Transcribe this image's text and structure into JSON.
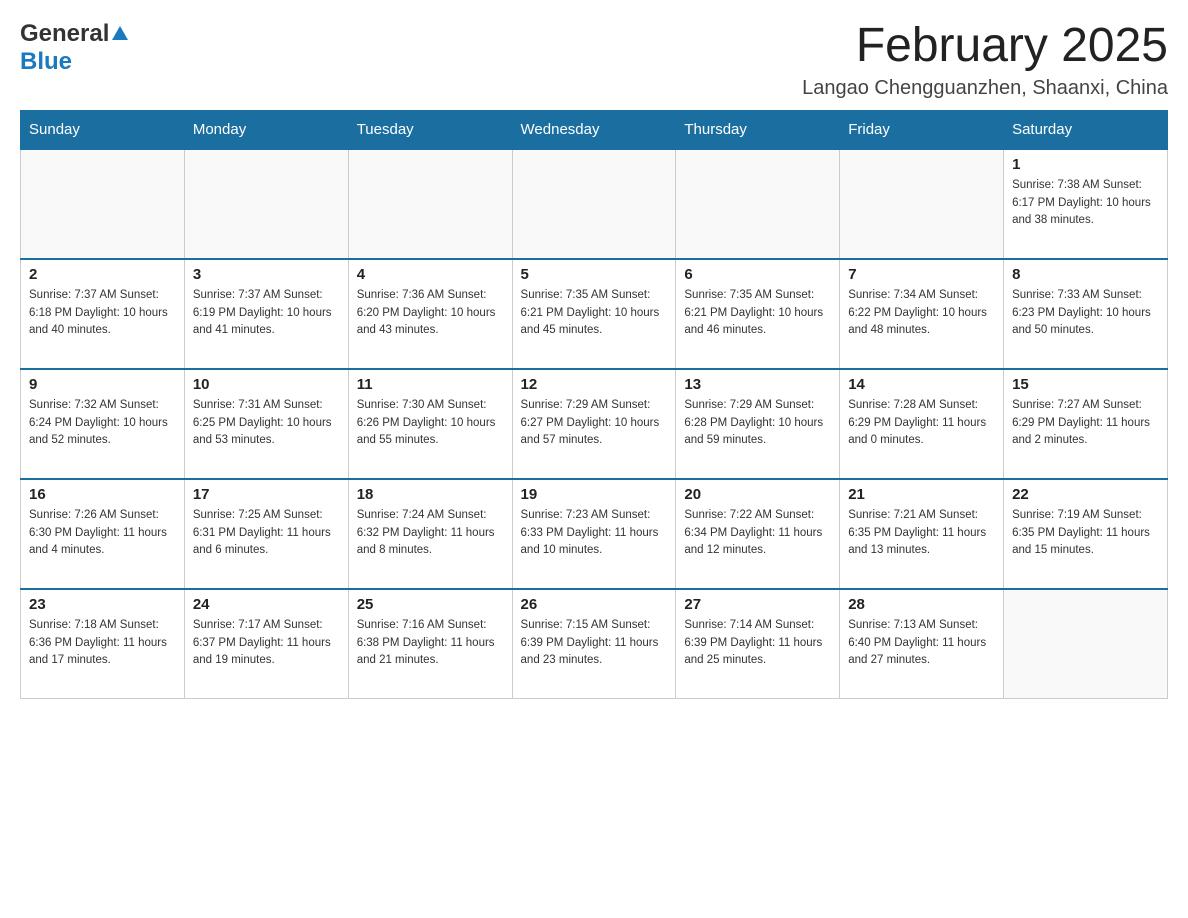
{
  "header": {
    "logo_general": "General",
    "logo_blue": "Blue",
    "month_title": "February 2025",
    "location": "Langao Chengguanzhen, Shaanxi, China"
  },
  "days_of_week": [
    "Sunday",
    "Monday",
    "Tuesday",
    "Wednesday",
    "Thursday",
    "Friday",
    "Saturday"
  ],
  "weeks": [
    [
      {
        "day": "",
        "info": ""
      },
      {
        "day": "",
        "info": ""
      },
      {
        "day": "",
        "info": ""
      },
      {
        "day": "",
        "info": ""
      },
      {
        "day": "",
        "info": ""
      },
      {
        "day": "",
        "info": ""
      },
      {
        "day": "1",
        "info": "Sunrise: 7:38 AM\nSunset: 6:17 PM\nDaylight: 10 hours and 38 minutes."
      }
    ],
    [
      {
        "day": "2",
        "info": "Sunrise: 7:37 AM\nSunset: 6:18 PM\nDaylight: 10 hours and 40 minutes."
      },
      {
        "day": "3",
        "info": "Sunrise: 7:37 AM\nSunset: 6:19 PM\nDaylight: 10 hours and 41 minutes."
      },
      {
        "day": "4",
        "info": "Sunrise: 7:36 AM\nSunset: 6:20 PM\nDaylight: 10 hours and 43 minutes."
      },
      {
        "day": "5",
        "info": "Sunrise: 7:35 AM\nSunset: 6:21 PM\nDaylight: 10 hours and 45 minutes."
      },
      {
        "day": "6",
        "info": "Sunrise: 7:35 AM\nSunset: 6:21 PM\nDaylight: 10 hours and 46 minutes."
      },
      {
        "day": "7",
        "info": "Sunrise: 7:34 AM\nSunset: 6:22 PM\nDaylight: 10 hours and 48 minutes."
      },
      {
        "day": "8",
        "info": "Sunrise: 7:33 AM\nSunset: 6:23 PM\nDaylight: 10 hours and 50 minutes."
      }
    ],
    [
      {
        "day": "9",
        "info": "Sunrise: 7:32 AM\nSunset: 6:24 PM\nDaylight: 10 hours and 52 minutes."
      },
      {
        "day": "10",
        "info": "Sunrise: 7:31 AM\nSunset: 6:25 PM\nDaylight: 10 hours and 53 minutes."
      },
      {
        "day": "11",
        "info": "Sunrise: 7:30 AM\nSunset: 6:26 PM\nDaylight: 10 hours and 55 minutes."
      },
      {
        "day": "12",
        "info": "Sunrise: 7:29 AM\nSunset: 6:27 PM\nDaylight: 10 hours and 57 minutes."
      },
      {
        "day": "13",
        "info": "Sunrise: 7:29 AM\nSunset: 6:28 PM\nDaylight: 10 hours and 59 minutes."
      },
      {
        "day": "14",
        "info": "Sunrise: 7:28 AM\nSunset: 6:29 PM\nDaylight: 11 hours and 0 minutes."
      },
      {
        "day": "15",
        "info": "Sunrise: 7:27 AM\nSunset: 6:29 PM\nDaylight: 11 hours and 2 minutes."
      }
    ],
    [
      {
        "day": "16",
        "info": "Sunrise: 7:26 AM\nSunset: 6:30 PM\nDaylight: 11 hours and 4 minutes."
      },
      {
        "day": "17",
        "info": "Sunrise: 7:25 AM\nSunset: 6:31 PM\nDaylight: 11 hours and 6 minutes."
      },
      {
        "day": "18",
        "info": "Sunrise: 7:24 AM\nSunset: 6:32 PM\nDaylight: 11 hours and 8 minutes."
      },
      {
        "day": "19",
        "info": "Sunrise: 7:23 AM\nSunset: 6:33 PM\nDaylight: 11 hours and 10 minutes."
      },
      {
        "day": "20",
        "info": "Sunrise: 7:22 AM\nSunset: 6:34 PM\nDaylight: 11 hours and 12 minutes."
      },
      {
        "day": "21",
        "info": "Sunrise: 7:21 AM\nSunset: 6:35 PM\nDaylight: 11 hours and 13 minutes."
      },
      {
        "day": "22",
        "info": "Sunrise: 7:19 AM\nSunset: 6:35 PM\nDaylight: 11 hours and 15 minutes."
      }
    ],
    [
      {
        "day": "23",
        "info": "Sunrise: 7:18 AM\nSunset: 6:36 PM\nDaylight: 11 hours and 17 minutes."
      },
      {
        "day": "24",
        "info": "Sunrise: 7:17 AM\nSunset: 6:37 PM\nDaylight: 11 hours and 19 minutes."
      },
      {
        "day": "25",
        "info": "Sunrise: 7:16 AM\nSunset: 6:38 PM\nDaylight: 11 hours and 21 minutes."
      },
      {
        "day": "26",
        "info": "Sunrise: 7:15 AM\nSunset: 6:39 PM\nDaylight: 11 hours and 23 minutes."
      },
      {
        "day": "27",
        "info": "Sunrise: 7:14 AM\nSunset: 6:39 PM\nDaylight: 11 hours and 25 minutes."
      },
      {
        "day": "28",
        "info": "Sunrise: 7:13 AM\nSunset: 6:40 PM\nDaylight: 11 hours and 27 minutes."
      },
      {
        "day": "",
        "info": ""
      }
    ]
  ]
}
